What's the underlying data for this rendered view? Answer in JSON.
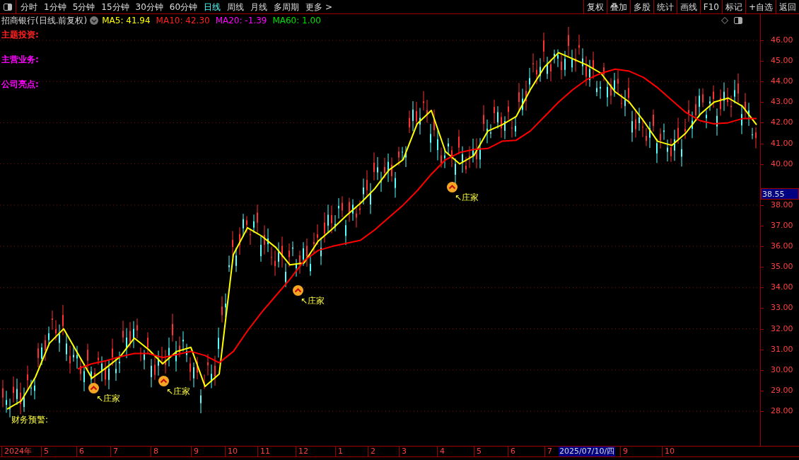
{
  "period_tabs": [
    {
      "label": "分时",
      "selected": false
    },
    {
      "label": "1分钟",
      "selected": false
    },
    {
      "label": "5分钟",
      "selected": false
    },
    {
      "label": "15分钟",
      "selected": false
    },
    {
      "label": "30分钟",
      "selected": false
    },
    {
      "label": "60分钟",
      "selected": false
    },
    {
      "label": "日线",
      "selected": true
    },
    {
      "label": "周线",
      "selected": false
    },
    {
      "label": "月线",
      "selected": false
    },
    {
      "label": "多周期",
      "selected": false
    },
    {
      "label": "更多 >",
      "selected": false
    }
  ],
  "toolbar_buttons": [
    "复权",
    "叠加",
    "多股",
    "统计",
    "画线",
    "F10",
    "标记",
    "+自选",
    "返回"
  ],
  "chart_title": "招商银行(日线.前复权)",
  "legend": [
    {
      "label": "MA5: 41.94",
      "color": "#ffff00"
    },
    {
      "label": "MA10: 42.30",
      "color": "#ff2020"
    },
    {
      "label": "MA20: -1.39",
      "color": "#ff00ff"
    },
    {
      "label": "MA60: 1.00",
      "color": "#00e000"
    }
  ],
  "indicator_labels": [
    {
      "text": "主题投资:",
      "color": "#ff2020"
    },
    {
      "text": "主营业务:",
      "color": "#ff00ff"
    },
    {
      "text": "公司亮点:",
      "color": "#ff00ff"
    }
  ],
  "warning_label": "财务预警:",
  "price_tag": "38.55",
  "time_axis": [
    {
      "label": "2024年",
      "selected": false
    },
    {
      "label": "5",
      "selected": false
    },
    {
      "label": "6",
      "selected": false
    },
    {
      "label": "7",
      "selected": false
    },
    {
      "label": "8",
      "selected": false
    },
    {
      "label": "9",
      "selected": false
    },
    {
      "label": "10",
      "selected": false
    },
    {
      "label": "11",
      "selected": false
    },
    {
      "label": "12",
      "selected": false
    },
    {
      "label": "1",
      "selected": false
    },
    {
      "label": "2",
      "selected": false
    },
    {
      "label": "3",
      "selected": false
    },
    {
      "label": "4",
      "selected": false
    },
    {
      "label": "5",
      "selected": false
    },
    {
      "label": "6",
      "selected": false
    },
    {
      "label": "7",
      "selected": false
    },
    {
      "label": "2025/07/10/四",
      "selected": true
    },
    {
      "label": "9",
      "selected": false
    },
    {
      "label": "10",
      "selected": false
    }
  ],
  "chart_data": {
    "type": "line",
    "ylim": [
      26.3,
      46.6
    ],
    "yticks": [
      {
        "value": 46,
        "label": "46.00"
      },
      {
        "value": 45,
        "label": "45.00"
      },
      {
        "value": 44,
        "label": "44.00"
      },
      {
        "value": 43,
        "label": "43.00"
      },
      {
        "value": 42,
        "label": "42.00"
      },
      {
        "value": 41,
        "label": "41.00"
      },
      {
        "value": 40,
        "label": "40.00"
      },
      {
        "value": 38,
        "label": "38.00"
      },
      {
        "value": 37,
        "label": "37.00"
      },
      {
        "value": 36,
        "label": "36.00"
      },
      {
        "value": 35,
        "label": "35.00"
      },
      {
        "value": 34,
        "label": "34.00"
      },
      {
        "value": 33,
        "label": "33.00"
      },
      {
        "value": 32,
        "label": "32.00"
      },
      {
        "value": 31,
        "label": "31.00"
      },
      {
        "value": 30,
        "label": "30.00"
      },
      {
        "value": 29,
        "label": "29.00"
      },
      {
        "value": 28,
        "label": "28.00"
      }
    ],
    "series": [
      {
        "color": "#ffff00",
        "values": [
          28.1,
          28.5,
          29.65,
          31.3,
          32.0,
          30.8,
          29.6,
          30.1,
          30.65,
          31.55,
          31.0,
          30.3,
          30.9,
          31.1,
          29.2,
          29.8,
          35.6,
          36.9,
          36.5,
          35.95,
          35.1,
          35.2,
          36.25,
          36.85,
          37.5,
          38.1,
          38.8,
          39.7,
          40.2,
          41.95,
          42.6,
          40.6,
          40.0,
          40.4,
          41.6,
          41.9,
          42.3,
          43.6,
          44.7,
          45.4,
          45.1,
          44.8,
          44.4,
          43.5,
          43.0,
          42.1,
          41.1,
          40.9,
          41.5,
          42.4,
          43.0,
          43.2,
          42.8,
          41.9
        ]
      },
      {
        "color": "#ff0000",
        "values": [
          null,
          null,
          null,
          null,
          null,
          30.05,
          30.3,
          30.45,
          30.65,
          30.8,
          30.8,
          30.6,
          30.75,
          30.9,
          30.7,
          30.35,
          30.9,
          31.9,
          32.8,
          33.6,
          34.4,
          35.3,
          35.8,
          36.0,
          36.15,
          36.3,
          36.8,
          37.4,
          38.0,
          38.7,
          39.5,
          40.2,
          40.55,
          40.7,
          40.75,
          41.1,
          41.15,
          41.6,
          42.3,
          43.0,
          43.6,
          44.1,
          44.4,
          44.6,
          44.5,
          44.2,
          43.7,
          43.1,
          42.5,
          42.1,
          41.95,
          42.0,
          42.2,
          42.2
        ]
      }
    ],
    "grid": true
  },
  "markers": [
    {
      "text": "↖庄家"
    },
    {
      "text": "↖庄家"
    },
    {
      "text": "↖庄家"
    },
    {
      "text": "↖庄家"
    }
  ]
}
